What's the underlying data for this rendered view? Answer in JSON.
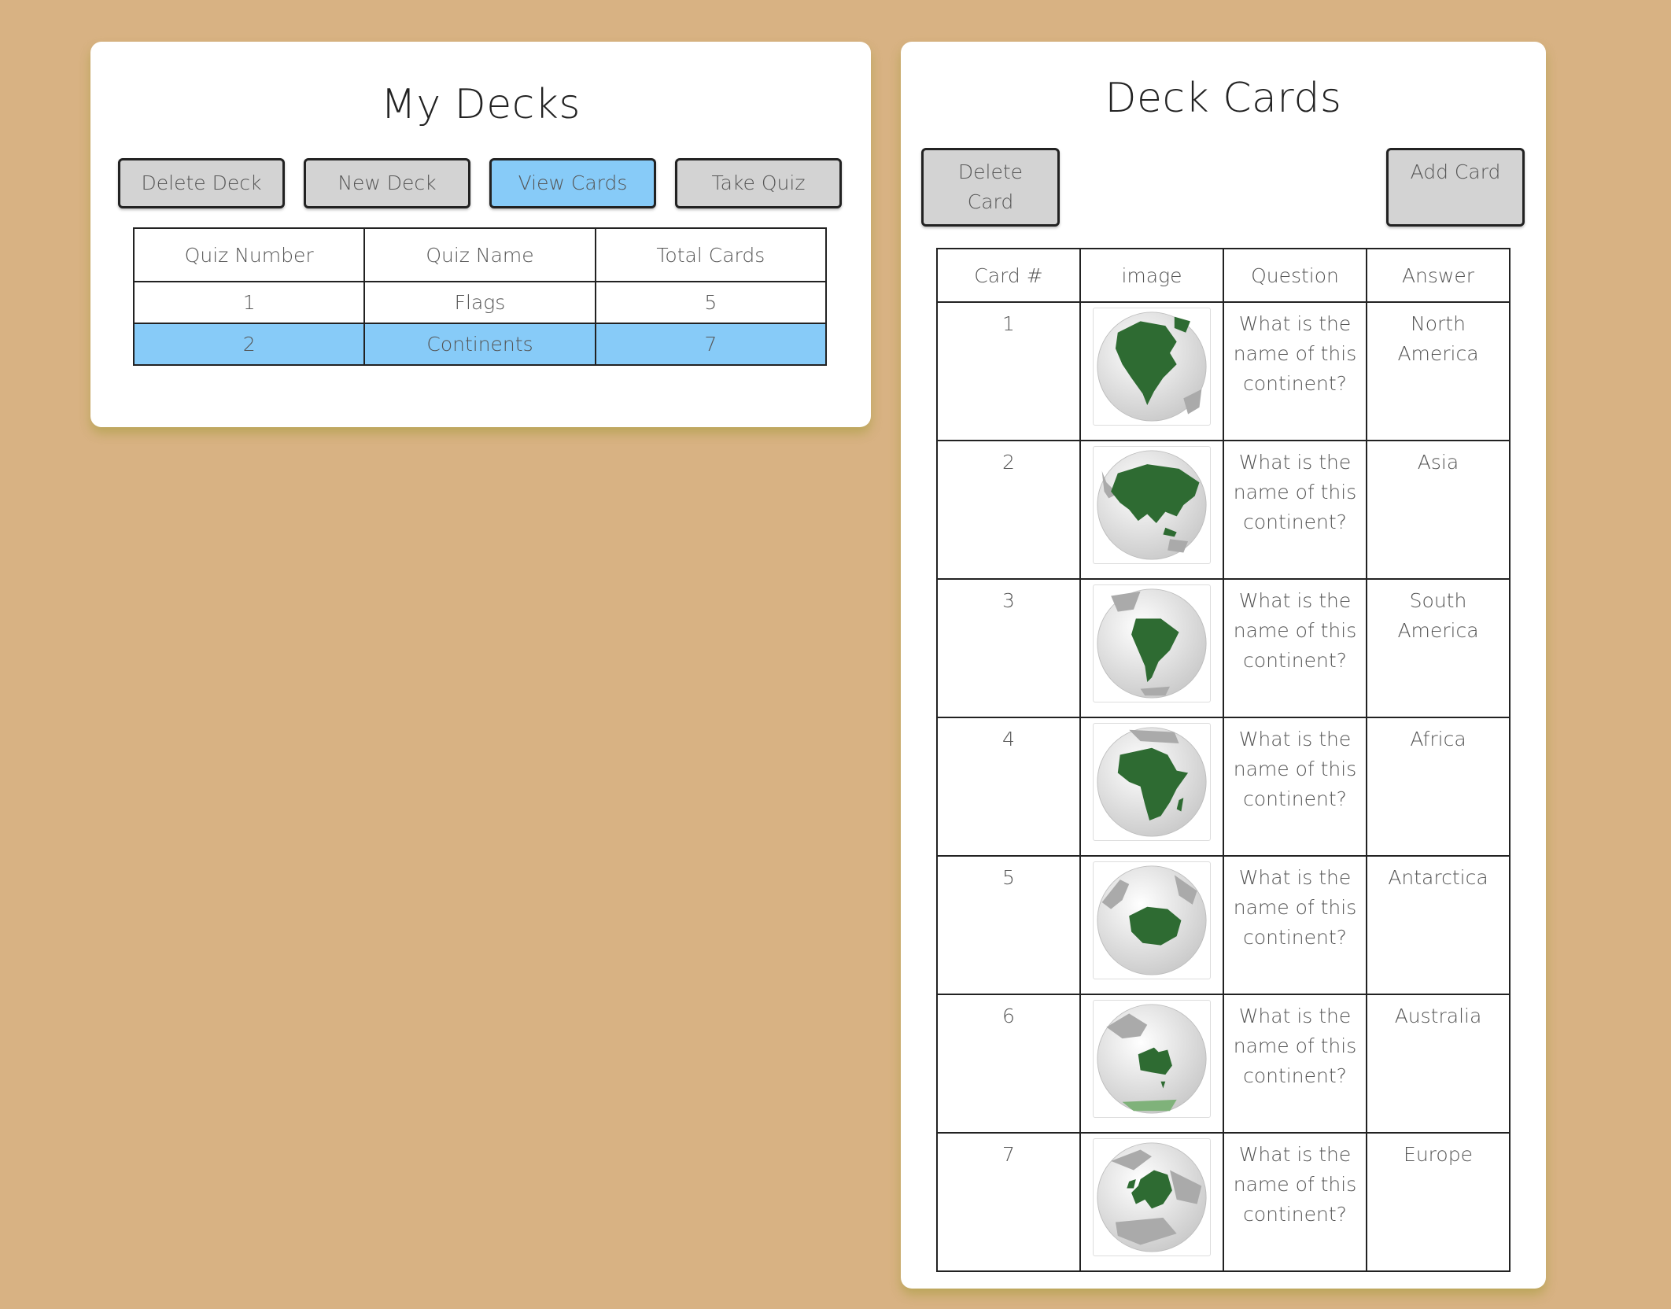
{
  "decks": {
    "title": "My Decks",
    "buttons": {
      "delete": "Delete Deck",
      "new": "New Deck",
      "view": "View Cards",
      "quiz": "Take Quiz"
    },
    "table": {
      "headers": [
        "Quiz Number",
        "Quiz Name",
        "Total Cards"
      ],
      "rows": [
        {
          "number": "1",
          "name": "Flags",
          "total": "5"
        },
        {
          "number": "2",
          "name": "Continents",
          "total": "7"
        }
      ]
    }
  },
  "cards": {
    "title": "Deck Cards",
    "buttons": {
      "delete": "Delete\nCard",
      "add": "Add Card"
    },
    "table": {
      "headers": [
        "Card #",
        "image",
        "Question",
        "Answer"
      ],
      "rows": [
        {
          "num": "1",
          "image": "globe-north-america-icon",
          "question": "What is the name of this continent?",
          "answer": "North America"
        },
        {
          "num": "2",
          "image": "globe-asia-icon",
          "question": "What is the name of this continent?",
          "answer": "Asia"
        },
        {
          "num": "3",
          "image": "globe-south-america-icon",
          "question": "What is the name of this continent?",
          "answer": "South America"
        },
        {
          "num": "4",
          "image": "globe-africa-icon",
          "question": "What is the name of this continent?",
          "answer": "Africa"
        },
        {
          "num": "5",
          "image": "globe-antarctica-icon",
          "question": "What is the name of this continent?",
          "answer": "Antarctica"
        },
        {
          "num": "6",
          "image": "globe-australia-icon",
          "question": "What is the name of this continent?",
          "answer": "Australia"
        },
        {
          "num": "7",
          "image": "globe-europe-icon",
          "question": "What is the name of this continent?",
          "answer": "Europe"
        }
      ]
    }
  },
  "colors": {
    "background": "#d8b283",
    "panel": "#ffffff",
    "selected": "#87cbf8",
    "button": "#d3d3d3",
    "continent": "#2e6b32"
  }
}
